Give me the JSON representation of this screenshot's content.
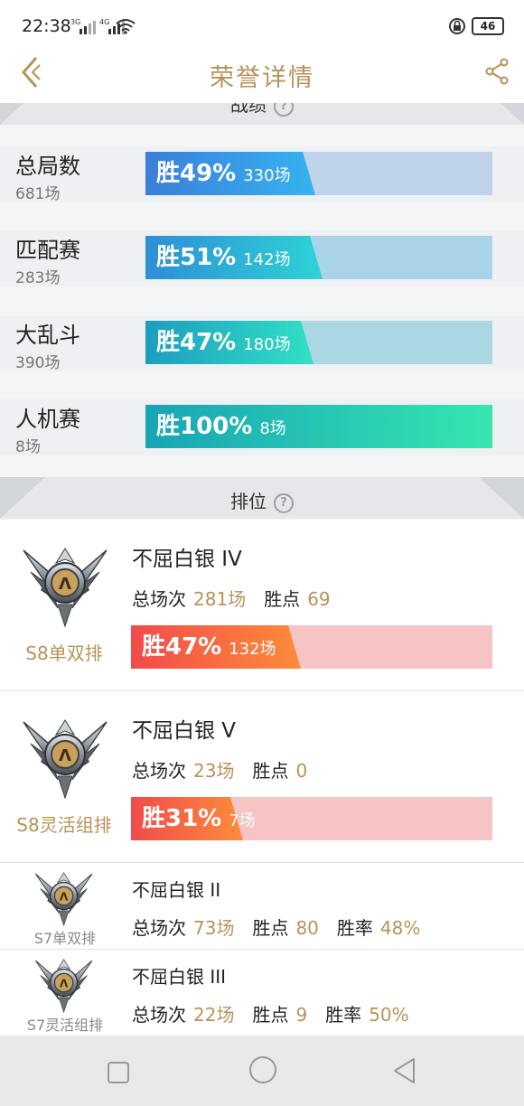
{
  "status": {
    "time": "22:38",
    "net1": "3G",
    "net2": "4G",
    "battery": "46"
  },
  "nav": {
    "title": "荣誉详情"
  },
  "sections": {
    "stats_title": "战绩",
    "rank_title": "排位"
  },
  "modes": [
    {
      "name": "总局数",
      "count": "681场",
      "win_label": "胜49%",
      "games": "330场",
      "win_rate": 0.49,
      "gradient": [
        "#3a7fd9",
        "#36b3f0"
      ],
      "track": "#bfd3ea"
    },
    {
      "name": "匹配赛",
      "count": "283场",
      "win_label": "胜51%",
      "games": "142场",
      "win_rate": 0.51,
      "gradient": [
        "#2e8ed6",
        "#2ed3d6"
      ],
      "track": "#a9d4e8"
    },
    {
      "name": "大乱斗",
      "count": "390场",
      "win_label": "胜47%",
      "games": "180场",
      "win_rate": 0.47,
      "gradient": [
        "#1c9ebf",
        "#32e0c4"
      ],
      "track": "#a9d8e3"
    },
    {
      "name": "人机赛",
      "count": "8场",
      "win_label": "胜100%",
      "games": "8场",
      "win_rate": 1.0,
      "gradient": [
        "#17a5b5",
        "#36e6b0"
      ],
      "track": "#a9e3d8"
    }
  ],
  "ranks": [
    {
      "label": "S8单双排",
      "tier": "不屈白银 IV",
      "total_label": "总场次",
      "total": "281场",
      "points_label": "胜点",
      "points": "69",
      "win_label": "胜47%",
      "games": "132场",
      "win_rate": 0.47
    },
    {
      "label": "S8灵活组排",
      "tier": "不屈白银 V",
      "total_label": "总场次",
      "total": "23场",
      "points_label": "胜点",
      "points": "0",
      "win_label": "胜31%",
      "games": "7场",
      "win_rate": 0.31
    },
    {
      "label": "S7单双排",
      "tier": "不屈白银 II",
      "total_label": "总场次",
      "total": "73场",
      "points_label": "胜点",
      "points": "80",
      "rate_label": "胜率",
      "rate": "48%"
    },
    {
      "label": "S7灵活组排",
      "tier": "不屈白银 III",
      "total_label": "总场次",
      "total": "22场",
      "points_label": "胜点",
      "points": "9",
      "rate_label": "胜率",
      "rate": "50%"
    }
  ],
  "colors": {
    "accent": "#b8925a",
    "rank_bar_from": "#f04b4b",
    "rank_bar_to": "#ff8c3a",
    "rank_track": "#f7c4c6"
  }
}
